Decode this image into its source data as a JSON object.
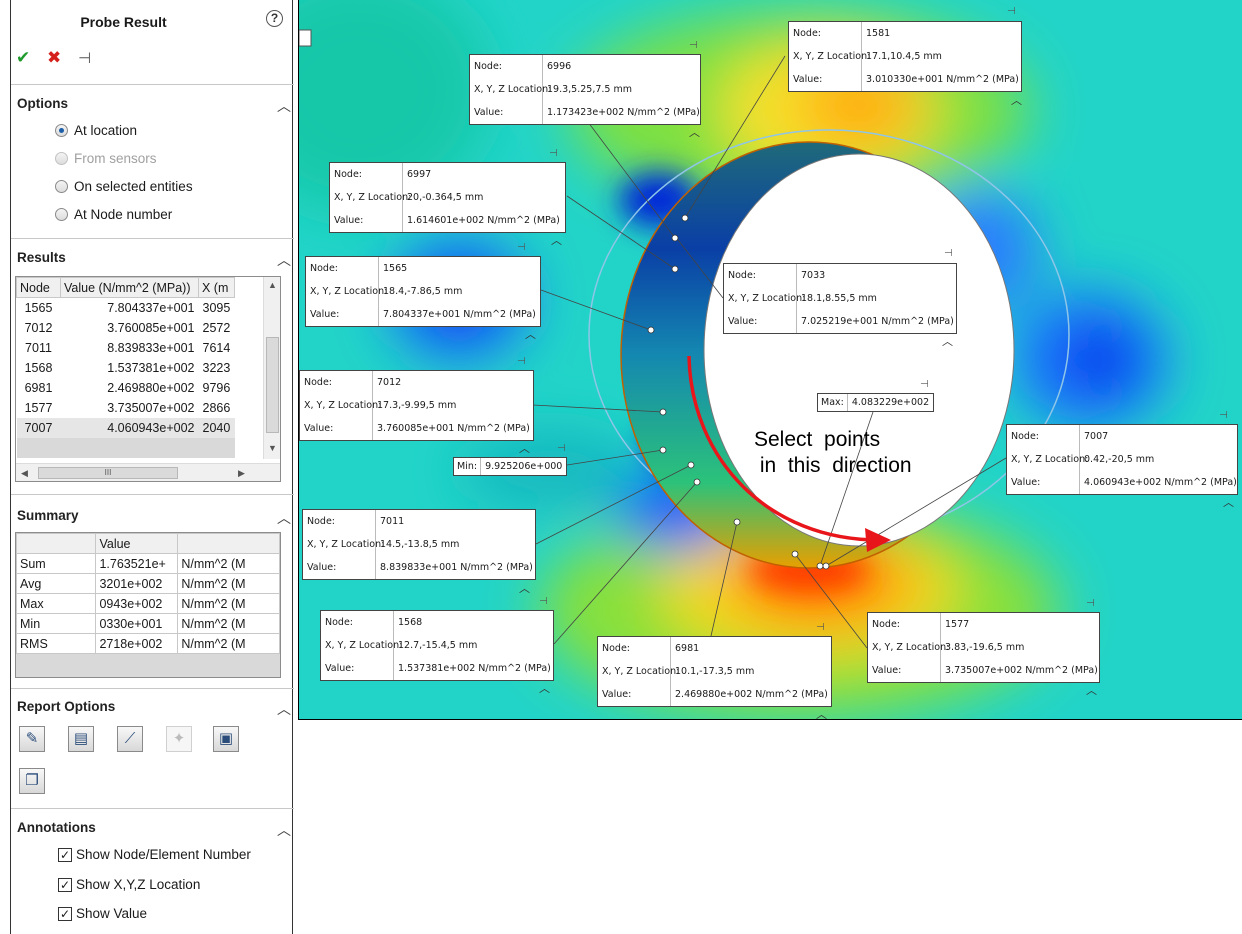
{
  "panel": {
    "title": "Probe Result",
    "help_glyph": "?",
    "ok_glyph": "✔",
    "cancel_glyph": "✖",
    "pin_glyph": "⊣",
    "options": {
      "header": "Options",
      "at_location": "At location",
      "from_sensors": "From sensors",
      "on_selected_entities": "On selected entities",
      "at_node_number": "At Node number",
      "selected": "At location"
    },
    "results": {
      "header": "Results",
      "columns": [
        "Node",
        "Value (N/mm^2 (MPa))",
        "X (m"
      ],
      "rows": [
        {
          "node": "1565",
          "value": "7.804337e+001",
          "x": "3095"
        },
        {
          "node": "7012",
          "value": "3.760085e+001",
          "x": "2572"
        },
        {
          "node": "7011",
          "value": "8.839833e+001",
          "x": "7614"
        },
        {
          "node": "1568",
          "value": "1.537381e+002",
          "x": "3223"
        },
        {
          "node": "6981",
          "value": "2.469880e+002",
          "x": "9796"
        },
        {
          "node": "1577",
          "value": "3.735007e+002",
          "x": "2866"
        },
        {
          "node": "7007",
          "value": "4.060943e+002",
          "x": "2040"
        }
      ]
    },
    "summary": {
      "header": "Summary",
      "column": "Value",
      "rows": [
        {
          "label": "Sum",
          "value": "1.763521e+",
          "unit": "N/mm^2 (M"
        },
        {
          "label": "Avg",
          "value": "3201e+002",
          "unit": "N/mm^2 (M"
        },
        {
          "label": "Max",
          "value": "0943e+002",
          "unit": "N/mm^2 (M"
        },
        {
          "label": "Min",
          "value": "0330e+001",
          "unit": "N/mm^2 (M"
        },
        {
          "label": "RMS",
          "value": "2718e+002",
          "unit": "N/mm^2 (M"
        }
      ]
    },
    "report_options": {
      "header": "Report Options",
      "tools": [
        "report-icon",
        "save-icon",
        "plot-icon",
        "sensor-icon",
        "image-icon",
        "copy-icon"
      ]
    },
    "annotations": {
      "header": "Annotations",
      "show_node": "Show Node/Element Number",
      "show_xyz": "Show X,Y,Z Location",
      "show_value": "Show Value",
      "checked": true
    }
  },
  "viewport": {
    "labels": {
      "node": "Node:",
      "xyz": "X, Y, Z Location:",
      "value": "Value:",
      "max": "Max:",
      "min": "Min:"
    },
    "callouts": [
      {
        "node": "1581",
        "xyz": "17.1,10.4,5 mm",
        "value": "3.010330e+001 N/mm^2 (MPa)"
      },
      {
        "node": "6996",
        "xyz": "19.3,5.25,7.5 mm",
        "value": "1.173423e+002 N/mm^2 (MPa)"
      },
      {
        "node": "6997",
        "xyz": "20,-0.364,5 mm",
        "value": "1.614601e+002 N/mm^2 (MPa)"
      },
      {
        "node": "1565",
        "xyz": "18.4,-7.86,5 mm",
        "value": "7.804337e+001 N/mm^2 (MPa)"
      },
      {
        "node": "7033",
        "xyz": "18.1,8.55,5 mm",
        "value": "7.025219e+001 N/mm^2 (MPa)"
      },
      {
        "node": "7012",
        "xyz": "17.3,-9.99,5 mm",
        "value": "3.760085e+001 N/mm^2 (MPa)"
      },
      {
        "node": "7007",
        "xyz": "0.42,-20,5 mm",
        "value": "4.060943e+002 N/mm^2 (MPa)"
      },
      {
        "node": "7011",
        "xyz": "14.5,-13.8,5 mm",
        "value": "8.839833e+001 N/mm^2 (MPa)"
      },
      {
        "node": "1568",
        "xyz": "12.7,-15.4,5 mm",
        "value": "1.537381e+002 N/mm^2 (MPa)"
      },
      {
        "node": "6981",
        "xyz": "10.1,-17.3,5 mm",
        "value": "2.469880e+002 N/mm^2 (MPa)"
      },
      {
        "node": "1577",
        "xyz": "3.83,-19.6,5 mm",
        "value": "3.735007e+002 N/mm^2 (MPa)"
      }
    ],
    "max_value": "4.083229e+002",
    "min_value": "9.925206e+000",
    "note_line1": "Select  points",
    "note_line2": " in  this  direction",
    "colors": {
      "arrow": "#e8161b",
      "high": "#ff2a00",
      "low": "#0030ff"
    }
  }
}
